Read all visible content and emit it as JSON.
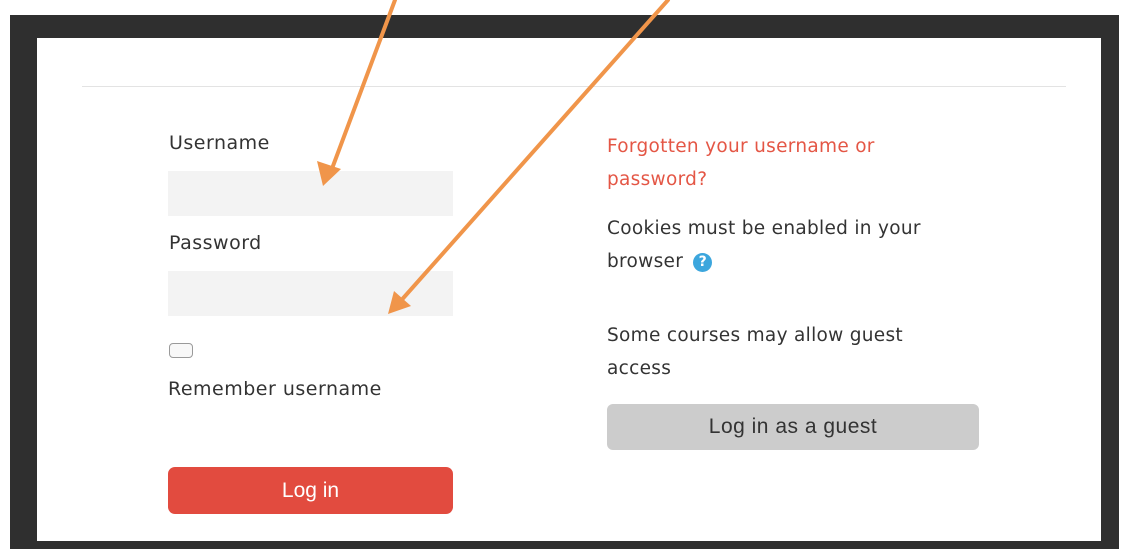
{
  "login": {
    "username_label": "Username",
    "username_value": "",
    "password_label": "Password",
    "password_value": "",
    "remember_checked": false,
    "remember_label": "Remember username",
    "login_button": "Log in"
  },
  "side": {
    "forgot_link": "Forgotten your username or password?",
    "cookies_text": "Cookies must be enabled in your browser",
    "help_icon_glyph": "?",
    "guest_text": "Some courses may allow guest access",
    "guest_button": "Log in as a guest"
  },
  "annotation": {
    "arrow_color": "#f0954a"
  },
  "colors": {
    "login_button": "#e24b3f",
    "link": "#e45645",
    "help_icon": "#3ca6dd",
    "guest_button": "#cccccc",
    "frame": "#2f2f2f"
  }
}
